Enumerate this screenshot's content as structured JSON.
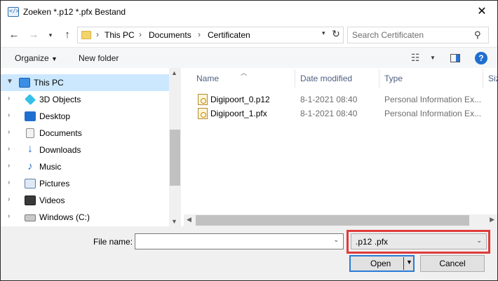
{
  "window": {
    "title": "Zoeken *.p12 *.pfx Bestand"
  },
  "address": {
    "crumbs": [
      "This PC",
      "Documents",
      "Certificaten"
    ]
  },
  "search": {
    "placeholder": "Search Certificaten"
  },
  "toolbar": {
    "organize_label": "Organize",
    "new_folder_label": "New folder"
  },
  "sidebar": {
    "items": [
      {
        "label": "This PC",
        "icon": "computer-icon",
        "selected": true
      },
      {
        "label": "3D Objects",
        "icon": "cube-icon"
      },
      {
        "label": "Desktop",
        "icon": "desktop-icon"
      },
      {
        "label": "Documents",
        "icon": "document-icon"
      },
      {
        "label": "Downloads",
        "icon": "download-icon"
      },
      {
        "label": "Music",
        "icon": "music-icon"
      },
      {
        "label": "Pictures",
        "icon": "pictures-icon"
      },
      {
        "label": "Videos",
        "icon": "video-icon"
      },
      {
        "label": "Windows (C:)",
        "icon": "drive-icon"
      }
    ]
  },
  "file_list": {
    "columns": [
      "Name",
      "Date modified",
      "Type",
      "Siz"
    ],
    "rows": [
      {
        "name": "Digipoort_0.p12",
        "date": "8-1-2021 08:40",
        "type": "Personal Information Ex..."
      },
      {
        "name": "Digipoort_1.pfx",
        "date": "8-1-2021 08:40",
        "type": "Personal Information Ex..."
      }
    ]
  },
  "bottom": {
    "file_name_label": "File name:",
    "file_name_value": "",
    "filter_value": ".p12 .pfx",
    "open_label": "Open",
    "cancel_label": "Cancel"
  },
  "colors": {
    "selection": "#cce8ff",
    "highlight_box": "#e03b3b",
    "accent": "#2a7bd6"
  }
}
